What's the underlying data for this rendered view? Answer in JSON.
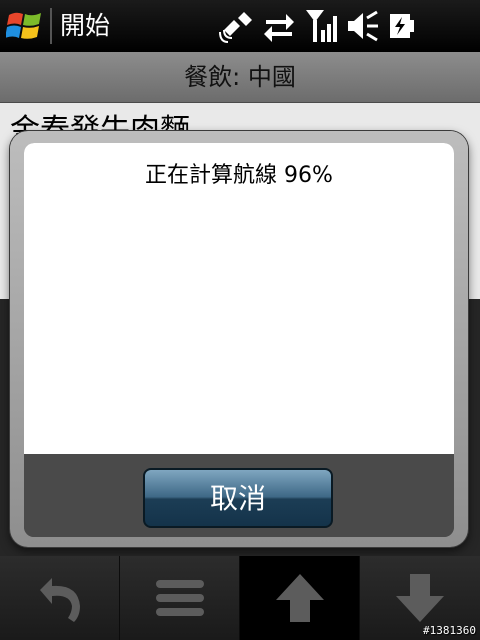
{
  "statusbar": {
    "start_label": "開始",
    "tray_icons": [
      "gps-signal-icon",
      "data-sync-icon",
      "signal-strength-icon",
      "speaker-muted-icon",
      "battery-charging-icon"
    ]
  },
  "app": {
    "header_title": "餐飲: 中國",
    "row_title": "金春發牛肉麵"
  },
  "dialog": {
    "message": "正在計算航線 96%",
    "progress_percent": 96,
    "cancel_label": "取消"
  },
  "toolbar": {
    "buttons": [
      "back-icon",
      "menu-icon",
      "up-arrow-icon",
      "down-arrow-icon"
    ],
    "active_index": 2
  },
  "watermark": "#1381360"
}
